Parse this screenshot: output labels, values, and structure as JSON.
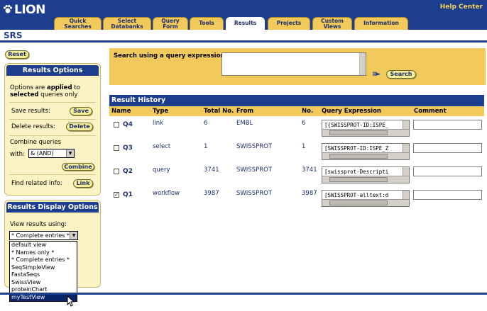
{
  "app": {
    "logo": "LION",
    "help_link": "Help Center",
    "section_title": "SRS"
  },
  "tabs": [
    {
      "label1": "Quick",
      "label2": "Searches"
    },
    {
      "label1": "Select",
      "label2": "Databanks"
    },
    {
      "label1": "Query",
      "label2": "Form"
    },
    {
      "label1": "Tools",
      "label2": ""
    },
    {
      "label1": "Results",
      "label2": ""
    },
    {
      "label1": "Projects",
      "label2": ""
    },
    {
      "label1": "Custom",
      "label2": "Views"
    },
    {
      "label1": "Information",
      "label2": ""
    }
  ],
  "left": {
    "reset_label": "Reset",
    "results_options": {
      "title": "Results Options",
      "note_1": "Options are",
      "note_bold1": "applied",
      "note_2": "to",
      "note_bold2": "selected",
      "note_3": "queries only",
      "save_label": "Save results:",
      "save_btn": "Save",
      "delete_label": "Delete results:",
      "delete_btn": "Delete",
      "combine_label": "Combine queries",
      "with_label": "with:",
      "with_value": "& (AND)",
      "combine_btn": "Combine",
      "find_label": "Find related info:",
      "link_btn": "Link"
    },
    "display_options": {
      "title": "Results Display Options",
      "view_label": "View results using:",
      "view_value": "* Complete entries *",
      "options": [
        "default view",
        "* Names only *",
        "* Complete entries *",
        "SeqSimpleView",
        "FastaSeqs",
        "SwissView",
        "proteinChart",
        "myTestView"
      ],
      "selected_index": 7
    }
  },
  "search": {
    "label": "Search using a query expression:",
    "button": "Search",
    "value": ""
  },
  "history": {
    "title": "Result History",
    "columns": [
      "Name",
      "Type",
      "Total No.",
      "From",
      "No.",
      "Query Expression",
      "Comment"
    ],
    "rows": [
      {
        "checked": false,
        "name": "Q4",
        "type": "link",
        "total": "6",
        "from": "EMBL",
        "no": "6",
        "expr": "[{SWISSPROT-ID:ISPE_"
      },
      {
        "checked": false,
        "name": "Q3",
        "type": "select",
        "total": "1",
        "from": "SWISSPROT",
        "no": "1",
        "expr": "[SWISSPROT-ID:ISPE_Z"
      },
      {
        "checked": false,
        "name": "Q2",
        "type": "query",
        "total": "3741",
        "from": "SWISSPROT",
        "no": "3741",
        "expr": "[swissprot-Descripti"
      },
      {
        "checked": true,
        "name": "Q1",
        "type": "workflow",
        "total": "3987",
        "from": "SWISSPROT",
        "no": "3987",
        "expr": "[SWISSPROT-alltext:d"
      }
    ]
  },
  "colors": {
    "navy": "#1d3d8f",
    "gold": "#f2c95b",
    "panel": "#fbf3c4",
    "button": "#f7ef9a"
  }
}
